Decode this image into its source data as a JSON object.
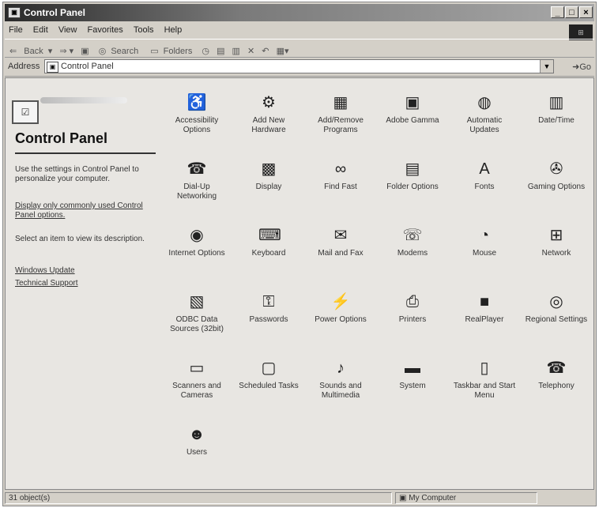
{
  "window": {
    "title": "Control Panel"
  },
  "menu": [
    "File",
    "Edit",
    "View",
    "Favorites",
    "Tools",
    "Help"
  ],
  "toolbar": {
    "back": "Back",
    "search": "Search",
    "folders": "Folders"
  },
  "address": {
    "label": "Address",
    "value": "Control Panel",
    "go": "Go"
  },
  "sidebar": {
    "title": "Control Panel",
    "intro": "Use the settings in Control Panel to personalize your computer.",
    "common_link": "Display only commonly used Control Panel options.",
    "select_hint": "Select an item to view its description.",
    "links": [
      "Windows Update",
      "Technical Support"
    ]
  },
  "items": [
    {
      "label": "Accessibility Options",
      "icon": "accessibility-icon",
      "glyph": "♿"
    },
    {
      "label": "Add New Hardware",
      "icon": "hardware-icon",
      "glyph": "⚙"
    },
    {
      "label": "Add/Remove Programs",
      "icon": "programs-icon",
      "glyph": "▦"
    },
    {
      "label": "Adobe Gamma",
      "icon": "monitor-icon",
      "glyph": "▣"
    },
    {
      "label": "Automatic Updates",
      "icon": "globe-icon",
      "glyph": "◍"
    },
    {
      "label": "Date/Time",
      "icon": "calendar-icon",
      "glyph": "▥"
    },
    {
      "label": "Dial-Up Networking",
      "icon": "dialup-icon",
      "glyph": "☎"
    },
    {
      "label": "Display",
      "icon": "display-icon",
      "glyph": "▩"
    },
    {
      "label": "Find Fast",
      "icon": "binoculars-icon",
      "glyph": "∞"
    },
    {
      "label": "Folder Options",
      "icon": "folder-icon",
      "glyph": "▤"
    },
    {
      "label": "Fonts",
      "icon": "fonts-icon",
      "glyph": "A"
    },
    {
      "label": "Gaming Options",
      "icon": "joystick-icon",
      "glyph": "✇"
    },
    {
      "label": "Internet Options",
      "icon": "internet-icon",
      "glyph": "◉"
    },
    {
      "label": "Keyboard",
      "icon": "keyboard-icon",
      "glyph": "⌨"
    },
    {
      "label": "Mail and Fax",
      "icon": "mail-icon",
      "glyph": "✉"
    },
    {
      "label": "Modems",
      "icon": "modem-icon",
      "glyph": "☏"
    },
    {
      "label": "Mouse",
      "icon": "mouse-icon",
      "glyph": "◔"
    },
    {
      "label": "Network",
      "icon": "network-icon",
      "glyph": "⊞"
    },
    {
      "label": "ODBC Data Sources (32bit)",
      "icon": "database-icon",
      "glyph": "▧"
    },
    {
      "label": "Passwords",
      "icon": "key-icon",
      "glyph": "⚿"
    },
    {
      "label": "Power Options",
      "icon": "power-icon",
      "glyph": "⚡"
    },
    {
      "label": "Printers",
      "icon": "printer-icon",
      "glyph": "⎙"
    },
    {
      "label": "RealPlayer",
      "icon": "realplayer-icon",
      "glyph": "■"
    },
    {
      "label": "Regional Settings",
      "icon": "globe-icon",
      "glyph": "◎"
    },
    {
      "label": "Scanners and Cameras",
      "icon": "scanner-icon",
      "glyph": "▭"
    },
    {
      "label": "Scheduled Tasks",
      "icon": "tasks-icon",
      "glyph": "▢"
    },
    {
      "label": "Sounds and Multimedia",
      "icon": "speaker-icon",
      "glyph": "♪"
    },
    {
      "label": "System",
      "icon": "computer-icon",
      "glyph": "▬"
    },
    {
      "label": "Taskbar and Start Menu",
      "icon": "taskbar-icon",
      "glyph": "▯"
    },
    {
      "label": "Telephony",
      "icon": "telephone-icon",
      "glyph": "☎"
    },
    {
      "label": "Users",
      "icon": "users-icon",
      "glyph": "☻"
    }
  ],
  "status": {
    "count": "31 object(s)",
    "zone": "My Computer"
  }
}
